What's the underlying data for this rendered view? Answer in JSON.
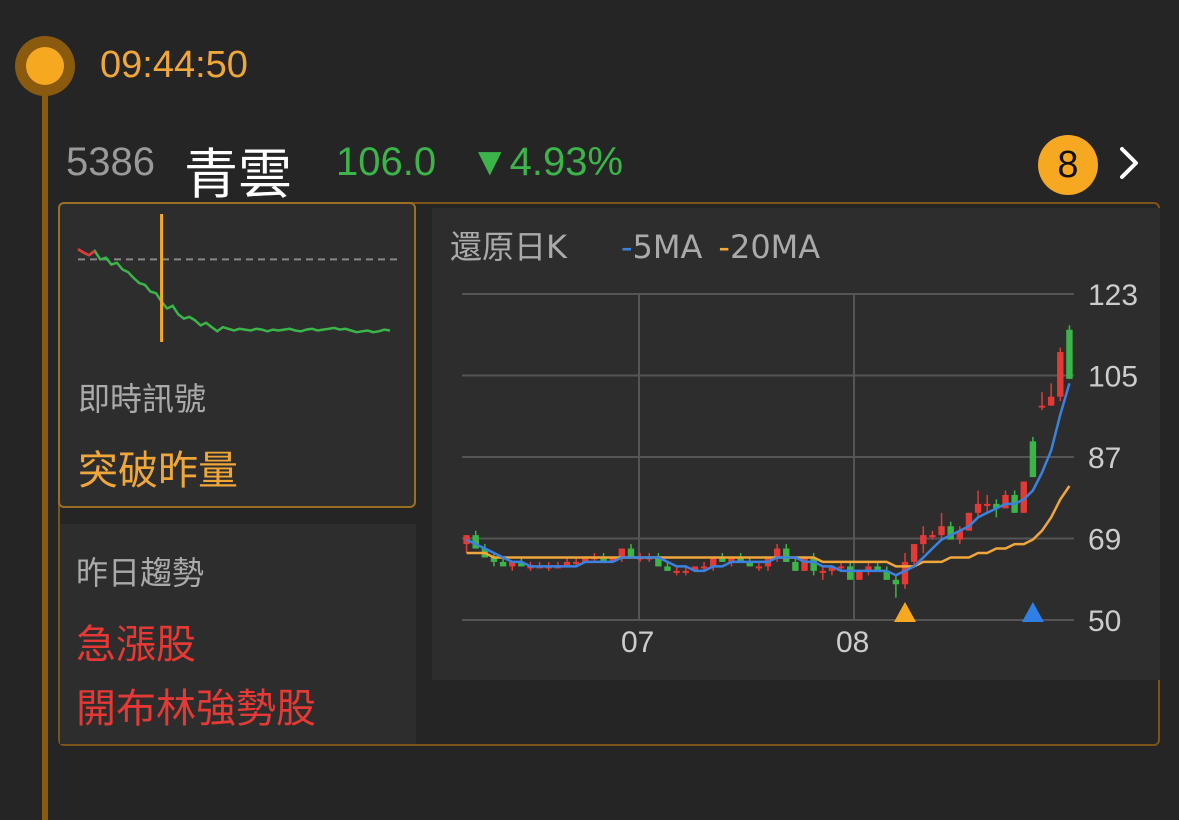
{
  "time": "09:44:50",
  "stock": {
    "code": "5386",
    "name": "青雲",
    "price": "106.0",
    "change": "▼4.93%",
    "badge_count": "8"
  },
  "signal": {
    "label": "即時訊號",
    "value": "突破昨量"
  },
  "trend": {
    "label": "昨日趨勢",
    "items": [
      "急漲股",
      "開布林強勢股"
    ]
  },
  "chart_data": {
    "type": "candlestick",
    "title": "還原日K",
    "legend": [
      {
        "name": "5MA",
        "color": "#3b82e0"
      },
      {
        "name": "20MA",
        "color": "#f0a73a"
      }
    ],
    "y_ticks": [
      "123",
      "105",
      "87",
      "69",
      "50"
    ],
    "ylim": [
      50,
      123
    ],
    "x_ticks": [
      "07",
      "08"
    ],
    "colors": {
      "up": "#e53935",
      "down": "#3bb54a"
    },
    "candles": [
      [
        67,
        69,
        65,
        69
      ],
      [
        69,
        70,
        66,
        66
      ],
      [
        66,
        67,
        64,
        64
      ],
      [
        64,
        65,
        62,
        63
      ],
      [
        63,
        64,
        62,
        62
      ],
      [
        62,
        63,
        61,
        63
      ],
      [
        63,
        64,
        62,
        62
      ],
      [
        62,
        63,
        61,
        62
      ],
      [
        62,
        63,
        62,
        62
      ],
      [
        62,
        63,
        61,
        62
      ],
      [
        62,
        63,
        62,
        62
      ],
      [
        62,
        64,
        62,
        63
      ],
      [
        63,
        64,
        62,
        63
      ],
      [
        63,
        64,
        63,
        64
      ],
      [
        64,
        65,
        63,
        64
      ],
      [
        64,
        65,
        63,
        63
      ],
      [
        63,
        64,
        63,
        64
      ],
      [
        64,
        66,
        63,
        66
      ],
      [
        66,
        67,
        64,
        64
      ],
      [
        64,
        65,
        63,
        64
      ],
      [
        64,
        65,
        63,
        64
      ],
      [
        64,
        65,
        62,
        62
      ],
      [
        62,
        63,
        61,
        61
      ],
      [
        61,
        62,
        60,
        61
      ],
      [
        61,
        62,
        60,
        61
      ],
      [
        61,
        62,
        61,
        62
      ],
      [
        62,
        63,
        61,
        62
      ],
      [
        62,
        64,
        61,
        64
      ],
      [
        64,
        65,
        63,
        63
      ],
      [
        63,
        64,
        62,
        64
      ],
      [
        64,
        65,
        63,
        63
      ],
      [
        63,
        64,
        62,
        62
      ],
      [
        62,
        63,
        61,
        62
      ],
      [
        62,
        64,
        61,
        64
      ],
      [
        64,
        67,
        63,
        66
      ],
      [
        66,
        67,
        63,
        63
      ],
      [
        63,
        64,
        61,
        61
      ],
      [
        61,
        64,
        61,
        64
      ],
      [
        64,
        65,
        60,
        61
      ],
      [
        61,
        62,
        59,
        61
      ],
      [
        61,
        62,
        60,
        62
      ],
      [
        62,
        63,
        61,
        62
      ],
      [
        62,
        63,
        59,
        59
      ],
      [
        59,
        61,
        59,
        61
      ],
      [
        61,
        63,
        60,
        62
      ],
      [
        62,
        63,
        61,
        61
      ],
      [
        61,
        62,
        59,
        59
      ],
      [
        59,
        60,
        55,
        58
      ],
      [
        58,
        65,
        57,
        63
      ],
      [
        63,
        67,
        62,
        67
      ],
      [
        67,
        71,
        65,
        69
      ],
      [
        69,
        70,
        68,
        69
      ],
      [
        69,
        74,
        68,
        71
      ],
      [
        71,
        72,
        68,
        68
      ],
      [
        68,
        71,
        67,
        70
      ],
      [
        70,
        74,
        70,
        74
      ],
      [
        74,
        79,
        73,
        76
      ],
      [
        76,
        78,
        74,
        76
      ],
      [
        76,
        77,
        73,
        75
      ],
      [
        75,
        79,
        75,
        78
      ],
      [
        78,
        79,
        74,
        74
      ],
      [
        74,
        81,
        74,
        81
      ],
      [
        90,
        91,
        82,
        82
      ],
      [
        98,
        101,
        97,
        98
      ],
      [
        98,
        103,
        98,
        100
      ],
      [
        100,
        111,
        99,
        110
      ],
      [
        115,
        116,
        104,
        104
      ]
    ],
    "ma5": [
      68,
      67,
      66,
      65,
      64,
      63,
      63,
      62,
      62,
      62,
      62,
      62,
      62,
      63,
      63,
      63,
      63,
      64,
      64,
      64,
      64,
      64,
      63,
      62,
      62,
      61,
      61,
      62,
      62,
      63,
      63,
      63,
      63,
      63,
      64,
      64,
      64,
      63,
      63,
      62,
      62,
      61,
      61,
      61,
      61,
      61,
      61,
      60,
      61,
      62,
      64,
      66,
      68,
      69,
      70,
      71,
      73,
      74,
      75,
      76,
      76,
      77,
      79,
      83,
      88,
      96,
      103
    ],
    "ma20": [
      65,
      65,
      65,
      64,
      64,
      64,
      64,
      64,
      64,
      64,
      64,
      64,
      64,
      64,
      64,
      64,
      64,
      64,
      64,
      64,
      64,
      64,
      64,
      64,
      64,
      64,
      64,
      64,
      64,
      64,
      64,
      64,
      64,
      64,
      64,
      64,
      64,
      64,
      64,
      63,
      63,
      63,
      63,
      63,
      63,
      63,
      63,
      62,
      62,
      62,
      63,
      63,
      63,
      64,
      64,
      64,
      65,
      65,
      66,
      66,
      67,
      67,
      68,
      70,
      73,
      77,
      80
    ],
    "markers": [
      {
        "index": 48,
        "color": "#f7a821"
      },
      {
        "index": 62,
        "color": "#2f7fe6"
      }
    ]
  },
  "intraday_data": {
    "prev_close_ratio": 0.5,
    "values": [
      0.62,
      0.58,
      0.55,
      0.6,
      0.5,
      0.52,
      0.44,
      0.46,
      0.38,
      0.35,
      0.28,
      0.22,
      0.2,
      0.12,
      0.1,
      0.0,
      -0.08,
      -0.05,
      -0.15,
      -0.2,
      -0.18,
      -0.22,
      -0.28,
      -0.25,
      -0.3,
      -0.35,
      -0.3,
      -0.32,
      -0.34,
      -0.32,
      -0.33,
      -0.34,
      -0.32,
      -0.33,
      -0.35,
      -0.33,
      -0.34,
      -0.33,
      -0.32,
      -0.34,
      -0.35,
      -0.33,
      -0.32,
      -0.34,
      -0.33,
      -0.32,
      -0.31,
      -0.33,
      -0.32,
      -0.34,
      -0.36,
      -0.35,
      -0.34,
      -0.36,
      -0.35,
      -0.33,
      -0.34
    ],
    "cursor_index": 15
  }
}
